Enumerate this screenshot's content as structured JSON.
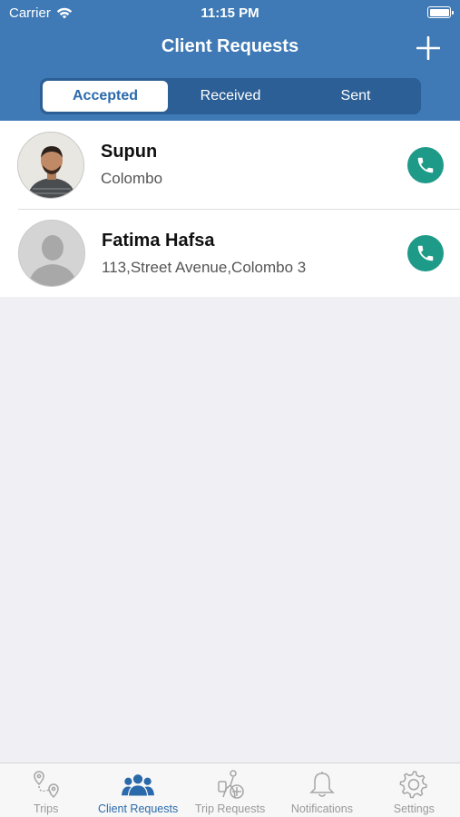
{
  "status_bar": {
    "carrier": "Carrier",
    "time": "11:15 PM"
  },
  "header": {
    "title": "Client Requests"
  },
  "segments": [
    {
      "label": "Accepted",
      "active": true
    },
    {
      "label": "Received",
      "active": false
    },
    {
      "label": "Sent",
      "active": false
    }
  ],
  "clients": [
    {
      "name": "Supun",
      "address": "Colombo"
    },
    {
      "name": "Fatima Hafsa",
      "address": "113,Street Avenue,Colombo 3"
    }
  ],
  "tabbar": {
    "tabs": [
      {
        "label": "Trips",
        "icon": "route-icon"
      },
      {
        "label": "Client Requests",
        "icon": "people-icon",
        "active": true
      },
      {
        "label": "Trip Requests",
        "icon": "traveler-icon"
      },
      {
        "label": "Notifications",
        "icon": "bell-icon"
      },
      {
        "label": "Settings",
        "icon": "gear-icon"
      }
    ]
  },
  "colors": {
    "header": "#3f7ab6",
    "segment_bg": "#2c5f95",
    "accent": "#2a6aaa",
    "call": "#1e9a88",
    "background": "#efeff4"
  }
}
